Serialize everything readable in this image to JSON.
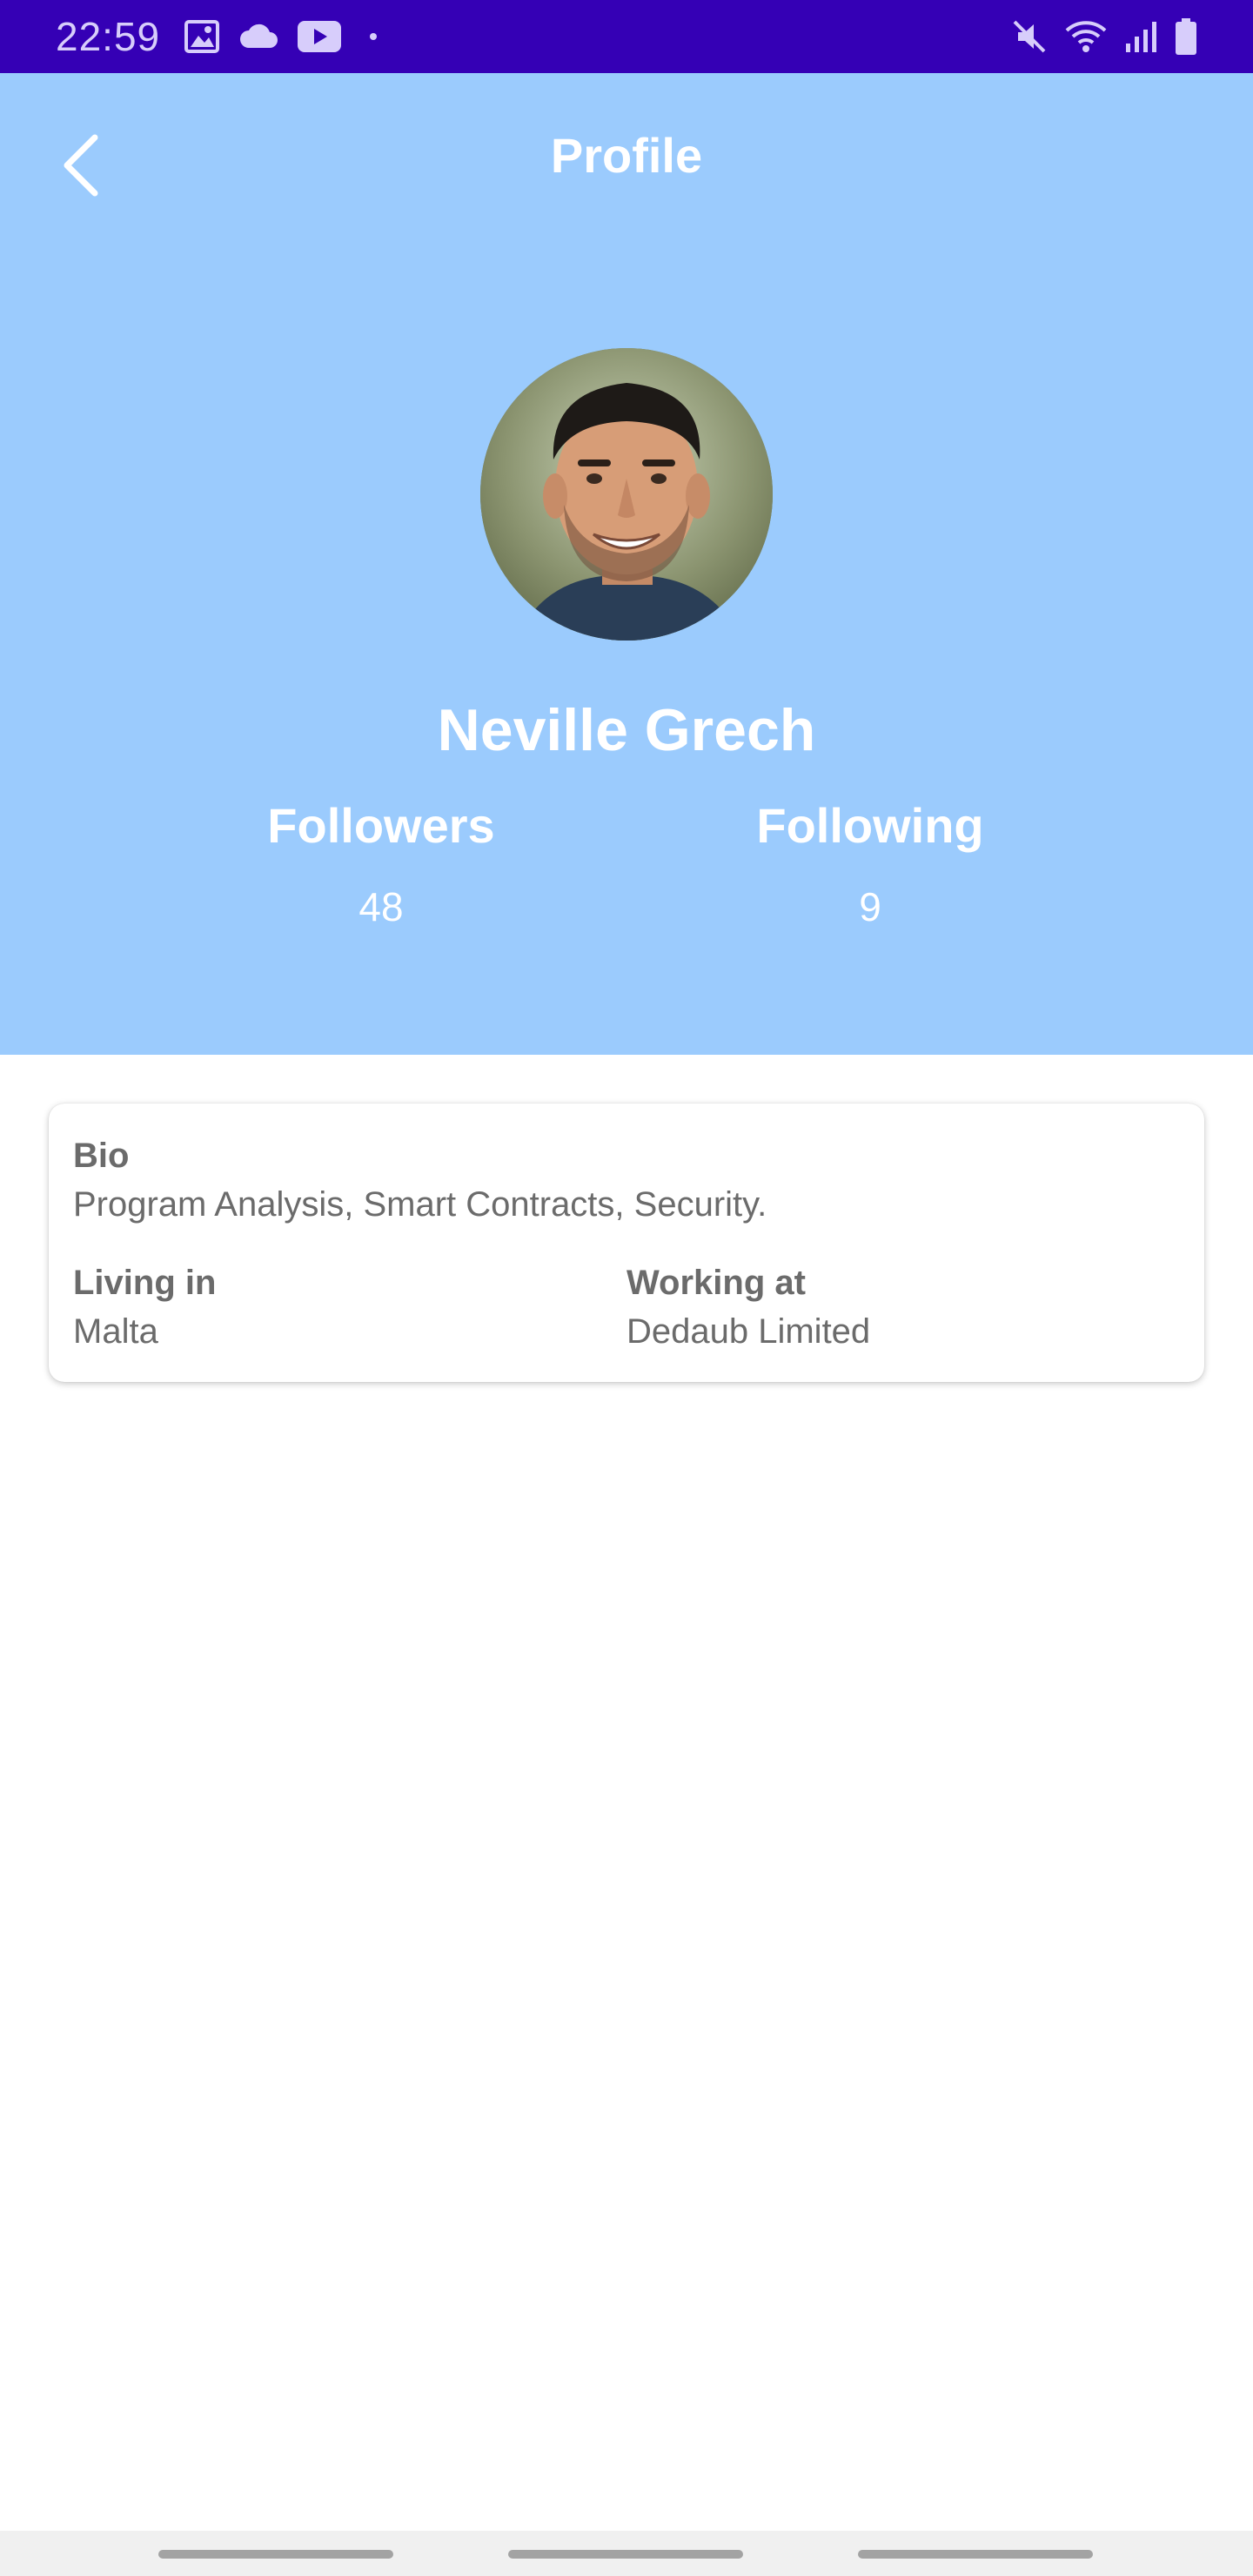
{
  "status_bar": {
    "time": "22:59",
    "icons": [
      "image-icon",
      "cloud-icon",
      "youtube-icon",
      "dot-icon",
      "mute-icon",
      "wifi-icon",
      "signal-icon",
      "battery-icon"
    ],
    "background": "#3500b5"
  },
  "header": {
    "title": "Profile",
    "back_icon": "chevron-left-icon",
    "background": "#9bcbfd"
  },
  "profile": {
    "name": "Neville Grech",
    "followers_label": "Followers",
    "followers_count": "48",
    "following_label": "Following",
    "following_count": "9"
  },
  "info": {
    "bio_label": "Bio",
    "bio_text": "Program Analysis, Smart Contracts, Security.",
    "living_label": "Living in",
    "living_value": "Malta",
    "working_label": "Working at",
    "working_value": "Dedaub Limited"
  }
}
